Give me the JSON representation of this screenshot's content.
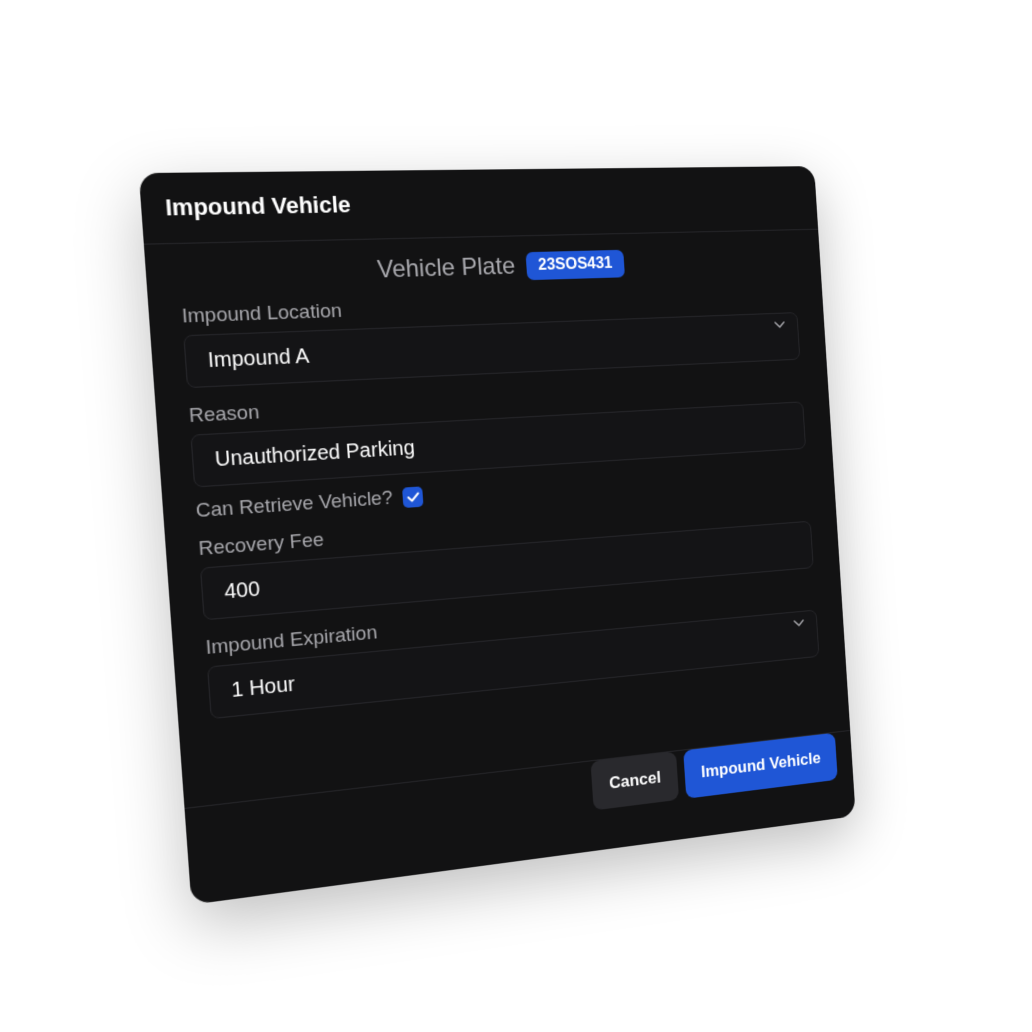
{
  "dialog": {
    "title": "Impound Vehicle"
  },
  "plate": {
    "label": "Vehicle Plate",
    "value": "23SOS431"
  },
  "fields": {
    "location": {
      "label": "Impound Location",
      "value": "Impound A"
    },
    "reason": {
      "label": "Reason",
      "value": "Unauthorized Parking"
    },
    "retrieve": {
      "label": "Can Retrieve Vehicle?",
      "checked": true
    },
    "fee": {
      "label": "Recovery Fee",
      "value": "400"
    },
    "expiration": {
      "label": "Impound Expiration",
      "value": "1 Hour"
    }
  },
  "buttons": {
    "cancel": "Cancel",
    "submit": "Impound Vehicle"
  },
  "colors": {
    "accent": "#1f56d6",
    "background": "#121213"
  },
  "icons": {
    "dropdown": "chevron-down-icon",
    "checkbox": "check-icon"
  }
}
